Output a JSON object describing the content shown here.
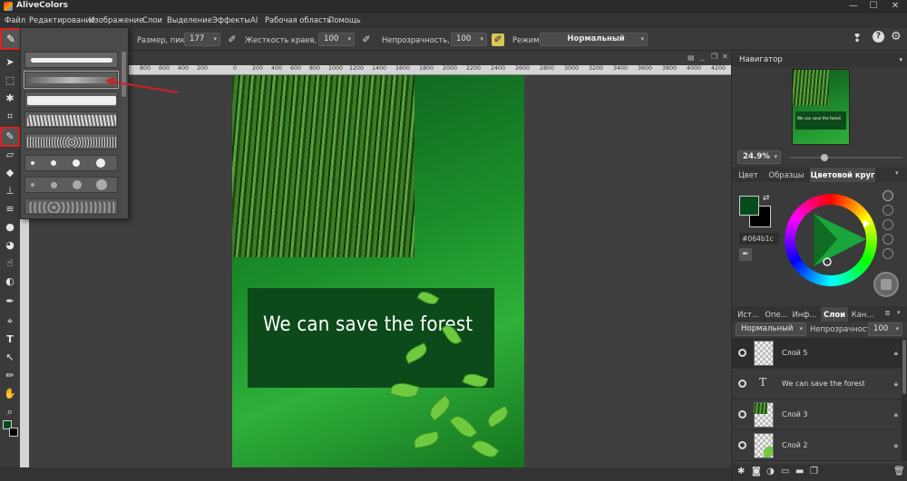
{
  "app": {
    "title": "AliveColors"
  },
  "menu": [
    "Файл",
    "Редактирование",
    "Изображение",
    "Слои",
    "Выделение",
    "Эффекты",
    "AI",
    "Рабочая область",
    "Помощь"
  ],
  "options": {
    "size_label": "Размер, пикс",
    "size_value": "177",
    "hardness_label": "Жесткость краев, %",
    "hardness_value": "100",
    "opacity_label": "Непрозрачность, %",
    "opacity_value": "100",
    "mode_label": "Режим:",
    "mode_value": "Нормальный"
  },
  "ruler_ticks": [
    "800",
    "600",
    "400",
    "200",
    "0",
    "200",
    "400",
    "600",
    "800",
    "1000",
    "1200",
    "1400",
    "1600",
    "1800",
    "2000",
    "2200",
    "2400",
    "2600",
    "2800",
    "3000",
    "3200",
    "3400",
    "3600",
    "3800",
    "4000",
    "4200"
  ],
  "canvas": {
    "headline": "We can save the forest"
  },
  "navigator": {
    "title": "Навигатор",
    "thumb_text": "We can save the forest",
    "zoom": "24.9%"
  },
  "color_panel": {
    "tabs": [
      "Цвет",
      "Образцы",
      "Цветовой круг"
    ],
    "active_tab": "Цветовой круг",
    "hex": "#064b1c",
    "fg_color": "#064b1c",
    "bg_color": "#000000"
  },
  "layers_panel": {
    "tabs": [
      "Ист...",
      "Опе...",
      "Инф...",
      "Слои",
      "Кан..."
    ],
    "active_tab": "Слои",
    "blend_mode": "Нормальный",
    "opacity_label": "Непрозрачность",
    "opacity_value": "100",
    "layers": [
      {
        "name": "Слой 5",
        "type": "raster",
        "selected": true
      },
      {
        "name": "We can save the forest",
        "type": "text",
        "selected": false
      },
      {
        "name": "Слой 3",
        "type": "raster",
        "selected": false
      },
      {
        "name": "Слой 2",
        "type": "raster",
        "selected": false
      }
    ]
  },
  "icons": {
    "text_layer": "T"
  }
}
